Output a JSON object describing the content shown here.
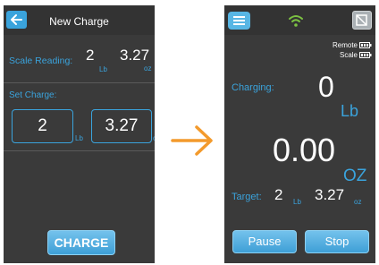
{
  "screen1": {
    "title": "New Charge",
    "scale_reading_label": "Scale Reading:",
    "scale_reading_lb_value": "2",
    "scale_reading_oz_value": "3.27",
    "unit_lb": "Lb",
    "unit_oz": "oz",
    "set_charge_label": "Set Charge:",
    "set_charge_lb_value": "2",
    "set_charge_oz_value": "3.27",
    "charge_button": "CHARGE"
  },
  "screen2": {
    "remote_label": "Remote",
    "scale_label": "Scale",
    "charging_label": "Charging:",
    "charging_lb_value": "0",
    "unit_lb": "Lb",
    "charging_oz_value": "0.00",
    "unit_oz_big": "OZ",
    "target_label": "Target:",
    "target_lb_value": "2",
    "target_unit_lb": "Lb",
    "target_oz_value": "3.27",
    "target_unit_oz": "oz",
    "pause_button": "Pause",
    "stop_button": "Stop"
  },
  "icons": {
    "back": "back-arrow-icon",
    "menu": "hamburger-menu-icon",
    "wifi": "wifi-icon",
    "disabled": "disabled-icon",
    "battery": "battery-icon",
    "transition": "right-arrow-icon"
  },
  "colors": {
    "accent_blue": "#3aa3dc",
    "screen_bg": "#3a3a3a",
    "wifi_green": "#7cc242",
    "arrow_orange": "#f39a2c"
  }
}
